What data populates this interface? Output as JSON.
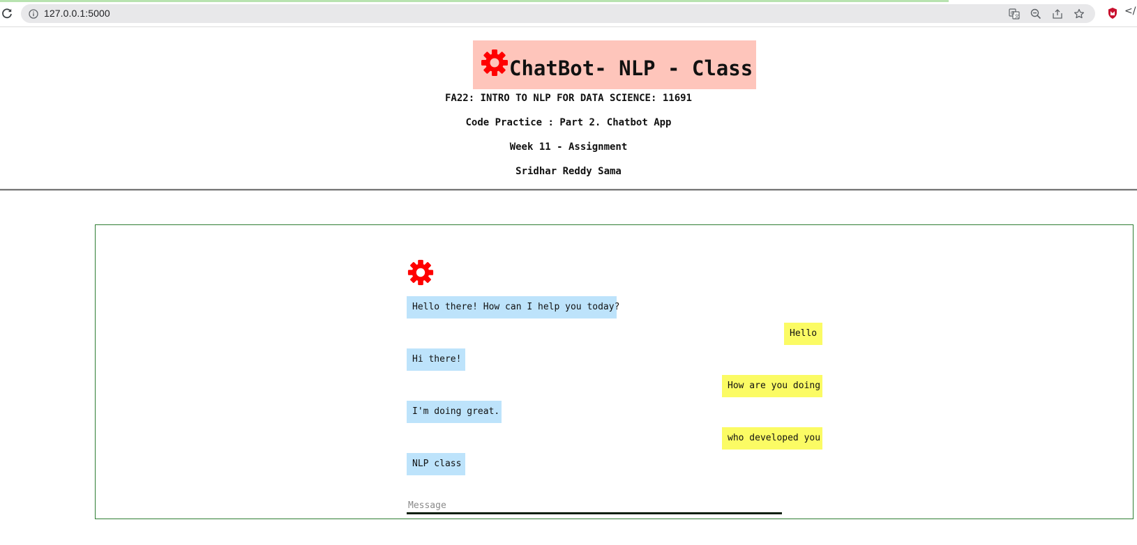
{
  "browser": {
    "url": "127.0.0.1:5000",
    "icons": {
      "reload": "reload-icon",
      "info": "site-info-icon",
      "translate": "translate-icon",
      "zoom": "zoom-out-icon",
      "share": "share-icon",
      "bookmark": "star-icon",
      "extension": "shield-extension-icon",
      "code": "code-icon"
    }
  },
  "header": {
    "title": "ChatBot- NLP - Class",
    "course": "FA22: INTRO TO NLP FOR DATA SCIENCE: 11691",
    "practice": "Code Practice : Part 2. Chatbot App",
    "week": "Week 11 - Assignment",
    "author": "Sridhar Reddy Sama",
    "title_bg": "#fec5bb",
    "gear_color": "#ff0000"
  },
  "chat": {
    "bot_color": "#bde3fb",
    "user_color": "#fbfb64",
    "messages": [
      {
        "sender": "bot",
        "text": "Hello there! How can I help you today?"
      },
      {
        "sender": "user",
        "text": "Hello"
      },
      {
        "sender": "bot",
        "text": "Hi there!"
      },
      {
        "sender": "user",
        "text": "How are you doing"
      },
      {
        "sender": "bot",
        "text": "I'm doing great."
      },
      {
        "sender": "user",
        "text": "who developed you"
      },
      {
        "sender": "bot",
        "text": "NLP class"
      }
    ],
    "input": {
      "placeholder": "Message",
      "value": ""
    }
  }
}
